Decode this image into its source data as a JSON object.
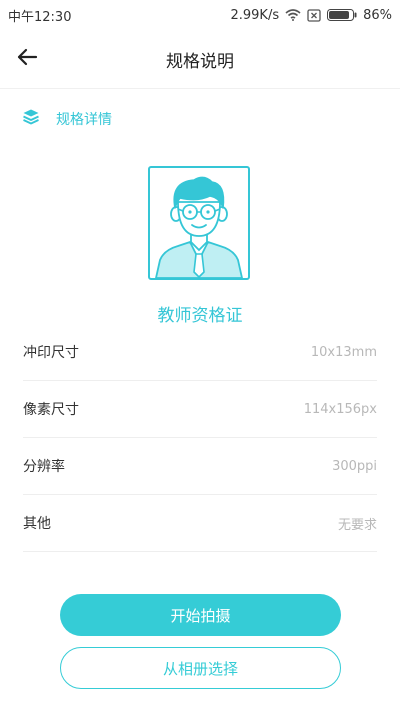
{
  "status_bar": {
    "time": "中午12:30",
    "speed": "2.99K/s",
    "battery": "86%"
  },
  "header": {
    "title": "规格说明",
    "back_icon": "arrow-left-icon"
  },
  "section": {
    "icon": "layers-icon",
    "title": "规格详情"
  },
  "certificate": {
    "name": "教师资格证",
    "photo_icon": "person-avatar-icon"
  },
  "specs": [
    {
      "label": "冲印尺寸",
      "value": "10x13mm"
    },
    {
      "label": "像素尺寸",
      "value": "114x156px"
    },
    {
      "label": "分辨率",
      "value": "300ppi"
    },
    {
      "label": "其他",
      "value": "无要求"
    }
  ],
  "actions": {
    "primary_label": "开始拍摄",
    "secondary_label": "从相册选择"
  },
  "colors": {
    "accent": "#35ccd6",
    "text": "#333333",
    "muted": "#b8b8b8"
  }
}
